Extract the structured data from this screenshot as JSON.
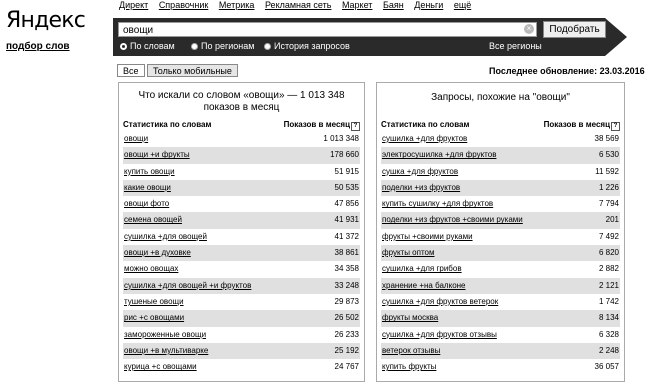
{
  "brand": {
    "logo": "Яндекс",
    "subtitle": "подбор слов"
  },
  "topnav": [
    "Директ",
    "Справочник",
    "Метрика",
    "Рекламная сеть",
    "Маркет",
    "Баян",
    "Деньги",
    "ещё"
  ],
  "search": {
    "value": "овощи",
    "button": "Подобрать",
    "clear_icon": "×"
  },
  "modes": [
    {
      "label": "По словам",
      "selected": true
    },
    {
      "label": "По регионам",
      "selected": false
    },
    {
      "label": "История запросов",
      "selected": false
    }
  ],
  "regions": "Все регионы",
  "tabs": {
    "all": "Все",
    "mobile": "Только мобильные"
  },
  "updated": "Последнее обновление: 23.03.2016",
  "left": {
    "title_line1": "Что искали со словом «овощи» — 1 013 348",
    "title_line2": "показов в месяц",
    "col_keyword": "Статистика по словам",
    "col_count": "Показов в месяц",
    "help_icon": "?",
    "rows": [
      {
        "kw": "овощи",
        "count": "1 013 348"
      },
      {
        "kw": "овощи +и фрукты",
        "count": "178 660"
      },
      {
        "kw": "купить овощи",
        "count": "51 915"
      },
      {
        "kw": "какие овощи",
        "count": "50 535"
      },
      {
        "kw": "овощи фото",
        "count": "47 856"
      },
      {
        "kw": "семена овощей",
        "count": "41 931"
      },
      {
        "kw": "сушилка +для овощей",
        "count": "41 372"
      },
      {
        "kw": "овощи +в духовке",
        "count": "38 861"
      },
      {
        "kw": "можно овощах",
        "count": "34 358"
      },
      {
        "kw": "сушилка +для овощей +и фруктов",
        "count": "33 248"
      },
      {
        "kw": "тушеные овощи",
        "count": "29 873"
      },
      {
        "kw": "рис +с овощами",
        "count": "26 502"
      },
      {
        "kw": "замороженные овощи",
        "count": "26 233"
      },
      {
        "kw": "овощи +в мультиварке",
        "count": "25 192"
      },
      {
        "kw": "курица +с овощами",
        "count": "24 767"
      }
    ]
  },
  "right": {
    "title": "Запросы, похожие на \"овощи\"",
    "col_keyword": "Статистика по словам",
    "col_count": "Показов в месяц",
    "help_icon": "?",
    "rows": [
      {
        "kw": "сушилка +для фруктов",
        "count": "38 569"
      },
      {
        "kw": "электросушилка +для фруктов",
        "count": "6 530"
      },
      {
        "kw": "сушка +для фруктов",
        "count": "11 592"
      },
      {
        "kw": "поделки +из фруктов",
        "count": "1 226"
      },
      {
        "kw": "купить сушилку +для фруктов",
        "count": "7 794"
      },
      {
        "kw": "поделки +из фруктов +своими руками",
        "count": "201"
      },
      {
        "kw": "фрукты +своими руками",
        "count": "7 492"
      },
      {
        "kw": "фрукты оптом",
        "count": "6 820"
      },
      {
        "kw": "сушилка +для грибов",
        "count": "2 882"
      },
      {
        "kw": "хранение +на балконе",
        "count": "2 121"
      },
      {
        "kw": "сушилка +для фруктов ветерок",
        "count": "1 742"
      },
      {
        "kw": "фрукты москва",
        "count": "8 134"
      },
      {
        "kw": "сушилка +для фруктов отзывы",
        "count": "6 328"
      },
      {
        "kw": "ветерок отзывы",
        "count": "2 248"
      },
      {
        "kw": "купить фрукты",
        "count": "36 057"
      }
    ]
  }
}
